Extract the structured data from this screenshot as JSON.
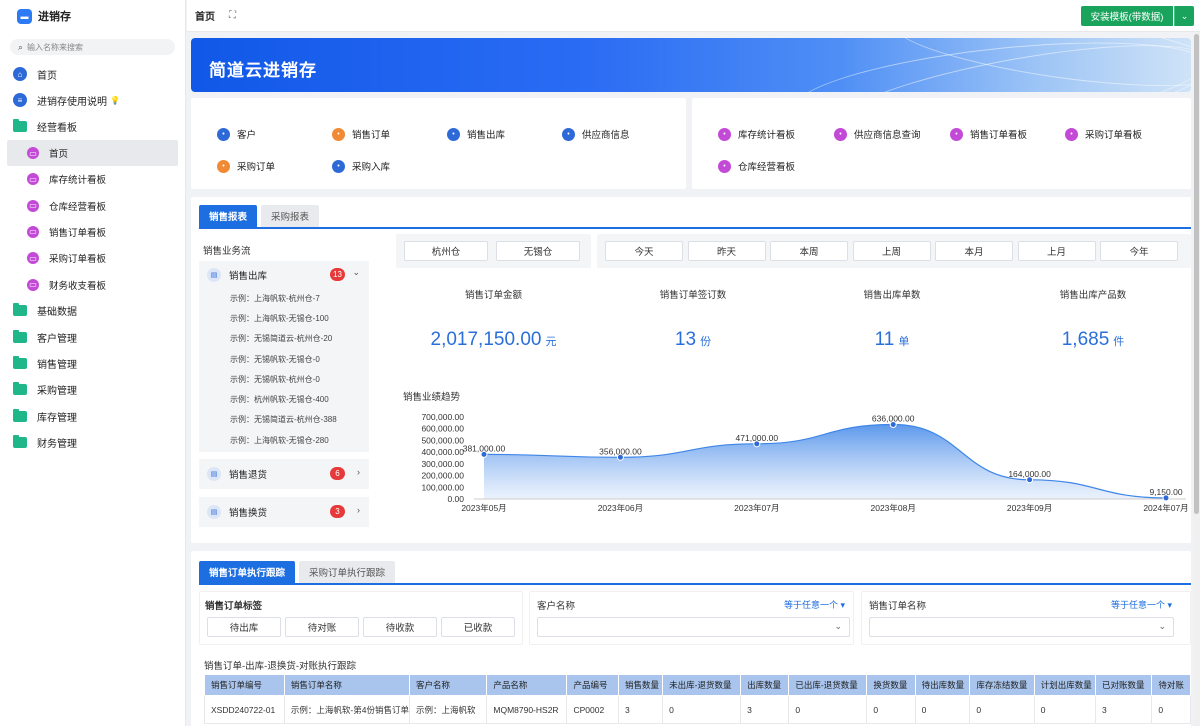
{
  "app": {
    "title": "进销存",
    "search_placeholder": "输入名称来搜索"
  },
  "sidebar": {
    "items": [
      {
        "label": "首页",
        "icon": "home-icon"
      },
      {
        "label": "进销存使用说明",
        "icon": "doc-icon",
        "extra": "bulb-icon"
      },
      {
        "label": "经营看板",
        "icon": "folder-icon"
      },
      {
        "label": "首页",
        "icon": "dashboard-icon"
      },
      {
        "label": "库存统计看板",
        "icon": "dashboard-icon"
      },
      {
        "label": "仓库经营看板",
        "icon": "dashboard-icon"
      },
      {
        "label": "销售订单看板",
        "icon": "dashboard-icon"
      },
      {
        "label": "采购订单看板",
        "icon": "dashboard-icon"
      },
      {
        "label": "财务收支看板",
        "icon": "dashboard-icon"
      },
      {
        "label": "基础数据",
        "icon": "folder-icon"
      },
      {
        "label": "客户管理",
        "icon": "folder-icon"
      },
      {
        "label": "销售管理",
        "icon": "folder-icon"
      },
      {
        "label": "采购管理",
        "icon": "folder-icon"
      },
      {
        "label": "库存管理",
        "icon": "folder-icon"
      },
      {
        "label": "财务管理",
        "icon": "folder-icon"
      }
    ]
  },
  "topbar": {
    "title": "首页",
    "install_label": "安装模板(带数据)"
  },
  "banner": {
    "title": "简道云进销存"
  },
  "quick_left": [
    {
      "label": "客户",
      "color": "#2d6ad8"
    },
    {
      "label": "销售订单",
      "color": "#f08a35"
    },
    {
      "label": "销售出库",
      "color": "#2d6ad8"
    },
    {
      "label": "供应商信息",
      "color": "#2d6ad8"
    },
    {
      "label": "采购订单",
      "color": "#f08a35"
    },
    {
      "label": "采购入库",
      "color": "#2d6ad8"
    }
  ],
  "quick_right": [
    {
      "label": "库存统计看板",
      "color": "#c34ad6"
    },
    {
      "label": "供应商信息查询",
      "color": "#c34ad6"
    },
    {
      "label": "销售订单看板",
      "color": "#c34ad6"
    },
    {
      "label": "采购订单看板",
      "color": "#c34ad6"
    },
    {
      "label": "仓库经营看板",
      "color": "#c34ad6"
    }
  ],
  "report_tabs": [
    "销售报表",
    "采购报表"
  ],
  "flow": {
    "title": "销售业务流",
    "sections": [
      {
        "label": "销售出库",
        "count": "13"
      },
      {
        "label": "销售退货",
        "count": "6"
      },
      {
        "label": "销售换货",
        "count": "3"
      }
    ],
    "rows": [
      "示例：上海帆软-杭州仓-7",
      "示例：上海帆软-无锡仓-100",
      "示例：无锡简道云-杭州仓-20",
      "示例：无锡帆软-无锡仓-0",
      "示例：无锡帆软-杭州仓-0",
      "示例：杭州帆软-无锡仓-400",
      "示例：无锡简道云-杭州仓-388",
      "示例：上海帆软-无锡仓-280"
    ]
  },
  "warehouses": [
    "杭州仓",
    "无锡仓"
  ],
  "periods": [
    "今天",
    "昨天",
    "本周",
    "上周",
    "本月",
    "上月",
    "今年"
  ],
  "stats": [
    {
      "title": "销售订单金额",
      "value": "2,017,150.00",
      "unit": "元"
    },
    {
      "title": "销售订单签订数",
      "value": "13",
      "unit": "份"
    },
    {
      "title": "销售出库单数",
      "value": "11",
      "unit": "单"
    },
    {
      "title": "销售出库产品数",
      "value": "1,685",
      "unit": "件"
    }
  ],
  "chart_title": "销售业绩趋势",
  "chart_data": {
    "type": "area",
    "x": [
      "2023年05月",
      "2023年06月",
      "2023年07月",
      "2023年08月",
      "2023年09月",
      "2024年07月"
    ],
    "values": [
      381000,
      356000,
      471000,
      636000,
      164000,
      9150
    ],
    "labels": [
      "381,000.00",
      "356,000.00",
      "471,000.00",
      "636,000.00",
      "164,000.00",
      "9,150.00"
    ],
    "yticks": [
      "700,000.00",
      "600,000.00",
      "500,000.00",
      "400,000.00",
      "300,000.00",
      "200,000.00",
      "100,000.00",
      "0.00"
    ],
    "ylim": [
      0,
      700000
    ],
    "color": "#3f86e8"
  },
  "order_tabs": [
    "销售订单执行跟踪",
    "采购订单执行跟踪"
  ],
  "filters": {
    "tag_title": "销售订单标签",
    "tags": [
      "待出库",
      "待对账",
      "待收款",
      "已收款"
    ],
    "customer_label": "客户名称",
    "order_label": "销售订单名称",
    "op_label": "等于任意一个"
  },
  "table": {
    "title": "销售订单-出库-退换货-对账执行跟踪",
    "headers": [
      "销售订单编号",
      "销售订单名称",
      "客户名称",
      "产品名称",
      "产品编号",
      "销售数量",
      "未出库-退货数量",
      "出库数量",
      "已出库-退货数量",
      "换货数量",
      "待出库数量",
      "库存冻结数量",
      "计划出库数量",
      "已对账数量",
      "待对账"
    ],
    "rows": [
      [
        "XSDD240722-01",
        "示例：上海帆软-第4份销售订单",
        "示例：上海帆软",
        "MQM8790-HS2R",
        "CP0002",
        "3",
        "0",
        "3",
        "0",
        "0",
        "0",
        "0",
        "0",
        "3",
        "0"
      ]
    ]
  }
}
